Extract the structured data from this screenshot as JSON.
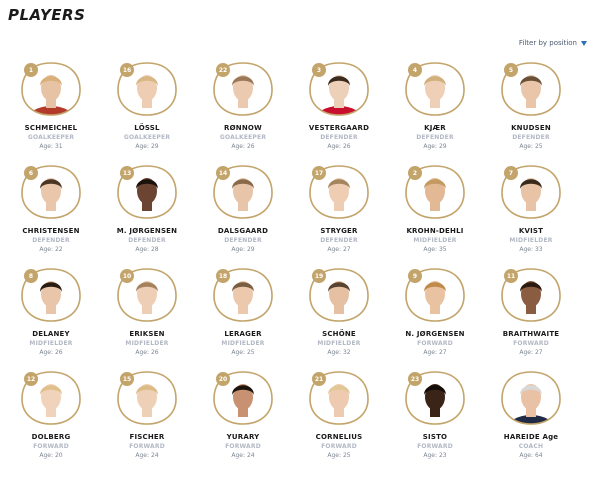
{
  "page_title": "PLAYERS",
  "filter_label": "Filter by position",
  "age_prefix": "Age:",
  "colors": {
    "gold": "#c3a46a",
    "filter_arrow": "#2b6fb6"
  },
  "players": [
    {
      "number": "1",
      "name": "SCHMEICHEL",
      "position": "GOALKEEPER",
      "age": "31",
      "shirt": "#b33a2a",
      "skin": "#e7c3a6",
      "hair": "#d9b07a"
    },
    {
      "number": "16",
      "name": "LÖSSL",
      "position": "GOALKEEPER",
      "age": "29",
      "shirt": "#ffffff",
      "skin": "#efcdb3",
      "hair": "#d8b784"
    },
    {
      "number": "22",
      "name": "RØNNOW",
      "position": "GOALKEEPER",
      "age": "26",
      "shirt": "#ffffff",
      "skin": "#eccab0",
      "hair": "#9a7858"
    },
    {
      "number": "3",
      "name": "VESTERGAARD",
      "position": "DEFENDER",
      "age": "26",
      "shirt": "#c8102e",
      "skin": "#edd0b8",
      "hair": "#3b2a1e"
    },
    {
      "number": "4",
      "name": "KJÆR",
      "position": "DEFENDER",
      "age": "29",
      "shirt": "#ffffff",
      "skin": "#efcfb5",
      "hair": "#d2b07c"
    },
    {
      "number": "5",
      "name": "KNUDSEN",
      "position": "DEFENDER",
      "age": "25",
      "shirt": "#ffffff",
      "skin": "#e9c6aa",
      "hair": "#6b5038"
    },
    {
      "number": "6",
      "name": "CHRISTENSEN",
      "position": "DEFENDER",
      "age": "22",
      "shirt": "#ffffff",
      "skin": "#eac6aa",
      "hair": "#4b3624"
    },
    {
      "number": "13",
      "name": "M. JØRGENSEN",
      "position": "DEFENDER",
      "age": "28",
      "shirt": "#ffffff",
      "skin": "#6b4532",
      "hair": "#1c120c"
    },
    {
      "number": "14",
      "name": "DALSGAARD",
      "position": "DEFENDER",
      "age": "29",
      "shirt": "#ffffff",
      "skin": "#e8c4a8",
      "hair": "#8a6a4a"
    },
    {
      "number": "17",
      "name": "STRYGER",
      "position": "DEFENDER",
      "age": "27",
      "shirt": "#ffffff",
      "skin": "#eecdb3",
      "hair": "#a5855e"
    },
    {
      "number": "2",
      "name": "KROHN-DEHLI",
      "position": "MIDFIELDER",
      "age": "35",
      "shirt": "#ffffff",
      "skin": "#e3b895",
      "hair": "#c29a62"
    },
    {
      "number": "7",
      "name": "KVIST",
      "position": "MIDFIELDER",
      "age": "33",
      "shirt": "#ffffff",
      "skin": "#e8c3a6",
      "hair": "#3a2a1c"
    },
    {
      "number": "8",
      "name": "DELANEY",
      "position": "MIDFIELDER",
      "age": "26",
      "shirt": "#ffffff",
      "skin": "#e9c5aa",
      "hair": "#2a1c12"
    },
    {
      "number": "10",
      "name": "ERIKSEN",
      "position": "MIDFIELDER",
      "age": "26",
      "shirt": "#ffffff",
      "skin": "#eecfb6",
      "hair": "#a5825c"
    },
    {
      "number": "18",
      "name": "LERAGER",
      "position": "MIDFIELDER",
      "age": "25",
      "shirt": "#ffffff",
      "skin": "#ecc9ad",
      "hair": "#7a5e42"
    },
    {
      "number": "19",
      "name": "SCHÖNE",
      "position": "MIDFIELDER",
      "age": "32",
      "shirt": "#ffffff",
      "skin": "#e6c0a2",
      "hair": "#5a4230"
    },
    {
      "number": "9",
      "name": "N. JØRGENSEN",
      "position": "FORWARD",
      "age": "27",
      "shirt": "#ffffff",
      "skin": "#e9c2a2",
      "hair": "#c08a4a"
    },
    {
      "number": "11",
      "name": "BRAITHWAITE",
      "position": "FORWARD",
      "age": "27",
      "shirt": "#ffffff",
      "skin": "#8a5c42",
      "hair": "#2a1a10"
    },
    {
      "number": "12",
      "name": "DOLBERG",
      "position": "FORWARD",
      "age": "20",
      "shirt": "#ffffff",
      "skin": "#f1d3bb",
      "hair": "#e0c08a"
    },
    {
      "number": "15",
      "name": "FISCHER",
      "position": "FORWARD",
      "age": "24",
      "shirt": "#ffffff",
      "skin": "#eed0b6",
      "hair": "#dcbb86"
    },
    {
      "number": "20",
      "name": "YURARY",
      "position": "FORWARD",
      "age": "24",
      "shirt": "#ffffff",
      "skin": "#c89272",
      "hair": "#1e140e"
    },
    {
      "number": "21",
      "name": "CORNELIUS",
      "position": "FORWARD",
      "age": "25",
      "shirt": "#ffffff",
      "skin": "#eecbb0",
      "hair": "#e2c896"
    },
    {
      "number": "23",
      "name": "SISTO",
      "position": "FORWARD",
      "age": "23",
      "shirt": "#ffffff",
      "skin": "#3a2418",
      "hair": "#140c08"
    },
    {
      "number": "",
      "name": "HAREIDE Age",
      "position": "COACH",
      "age": "64",
      "shirt": "#1f2a44",
      "skin": "#e9c2a6",
      "hair": "#d8d8d8"
    }
  ]
}
